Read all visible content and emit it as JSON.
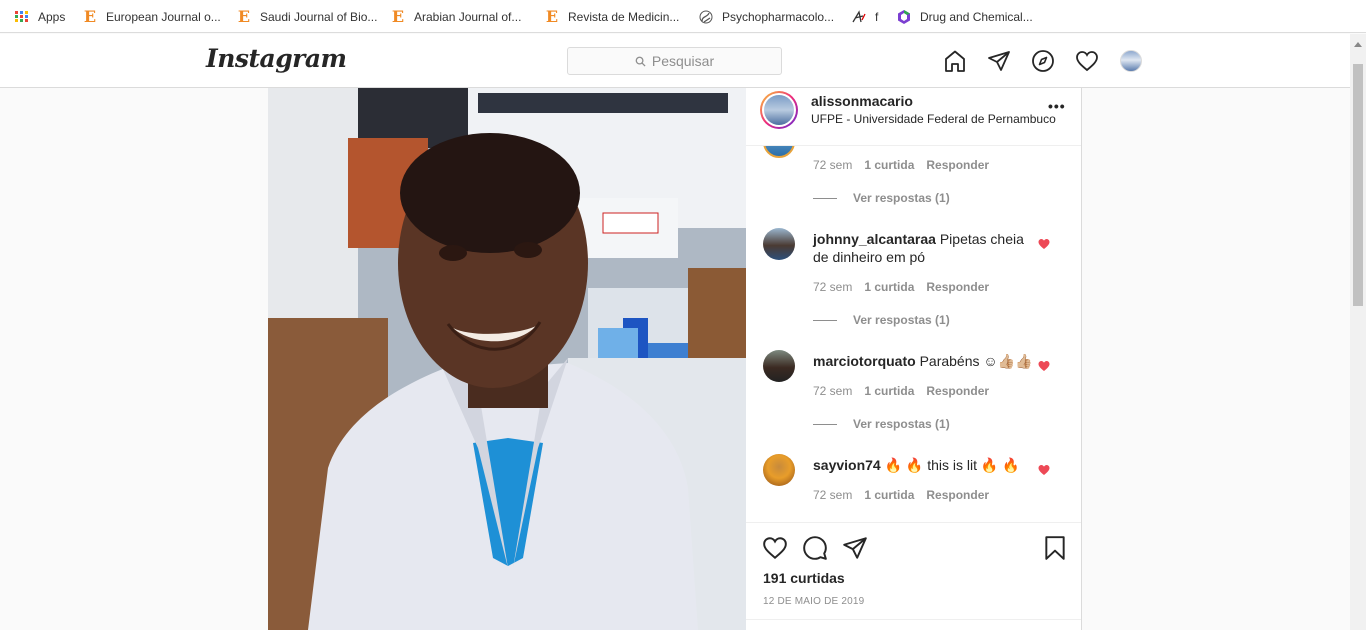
{
  "bookmarks": [
    {
      "label": "Apps",
      "icon": "apps-grid-icon"
    },
    {
      "label": "European Journal o...",
      "icon": "elsevier-e-icon"
    },
    {
      "label": "Saudi Journal of Bio...",
      "icon": "elsevier-e-icon"
    },
    {
      "label": "Arabian Journal of...",
      "icon": "elsevier-e-icon"
    },
    {
      "label": "Revista de Medicin...",
      "icon": "elsevier-e-icon"
    },
    {
      "label": "Psychopharmacolo...",
      "icon": "springer-icon"
    },
    {
      "label": "f",
      "icon": "f-icon"
    },
    {
      "label": "Drug and Chemical...",
      "icon": "taylor-francis-icon"
    }
  ],
  "header": {
    "logo": "Instagram",
    "search_placeholder": "Pesquisar"
  },
  "post": {
    "author": "alissonmacario",
    "location": "UFPE - Universidade Federal de Pernambuco",
    "more": "•••",
    "comments": [
      {
        "user": "",
        "text": "",
        "time": "72 sem",
        "likes": "1 curtida",
        "reply": "Responder",
        "replies": "Ver respostas (1)"
      },
      {
        "user": "johnny_alcantaraa",
        "text": "Pipetas cheia de dinheiro em pó",
        "time": "72 sem",
        "likes": "1 curtida",
        "reply": "Responder",
        "replies": "Ver respostas (1)"
      },
      {
        "user": "marciotorquato",
        "text": "Parabéns ☺👍🏼👍🏼",
        "time": "72 sem",
        "likes": "1 curtida",
        "reply": "Responder",
        "replies": "Ver respostas (1)"
      },
      {
        "user": "sayvion74",
        "text": "🔥 🔥 this is lit 🔥 🔥",
        "time": "72 sem",
        "likes": "1 curtida",
        "reply": "Responder",
        "replies": ""
      }
    ],
    "likes_count": "191 curtidas",
    "date": "12 DE MAIO DE 2019"
  },
  "colors": {
    "heart_red": "#ed4956",
    "text_primary": "#262626",
    "text_secondary": "#8e8e8e",
    "border": "#dbdbdb"
  }
}
